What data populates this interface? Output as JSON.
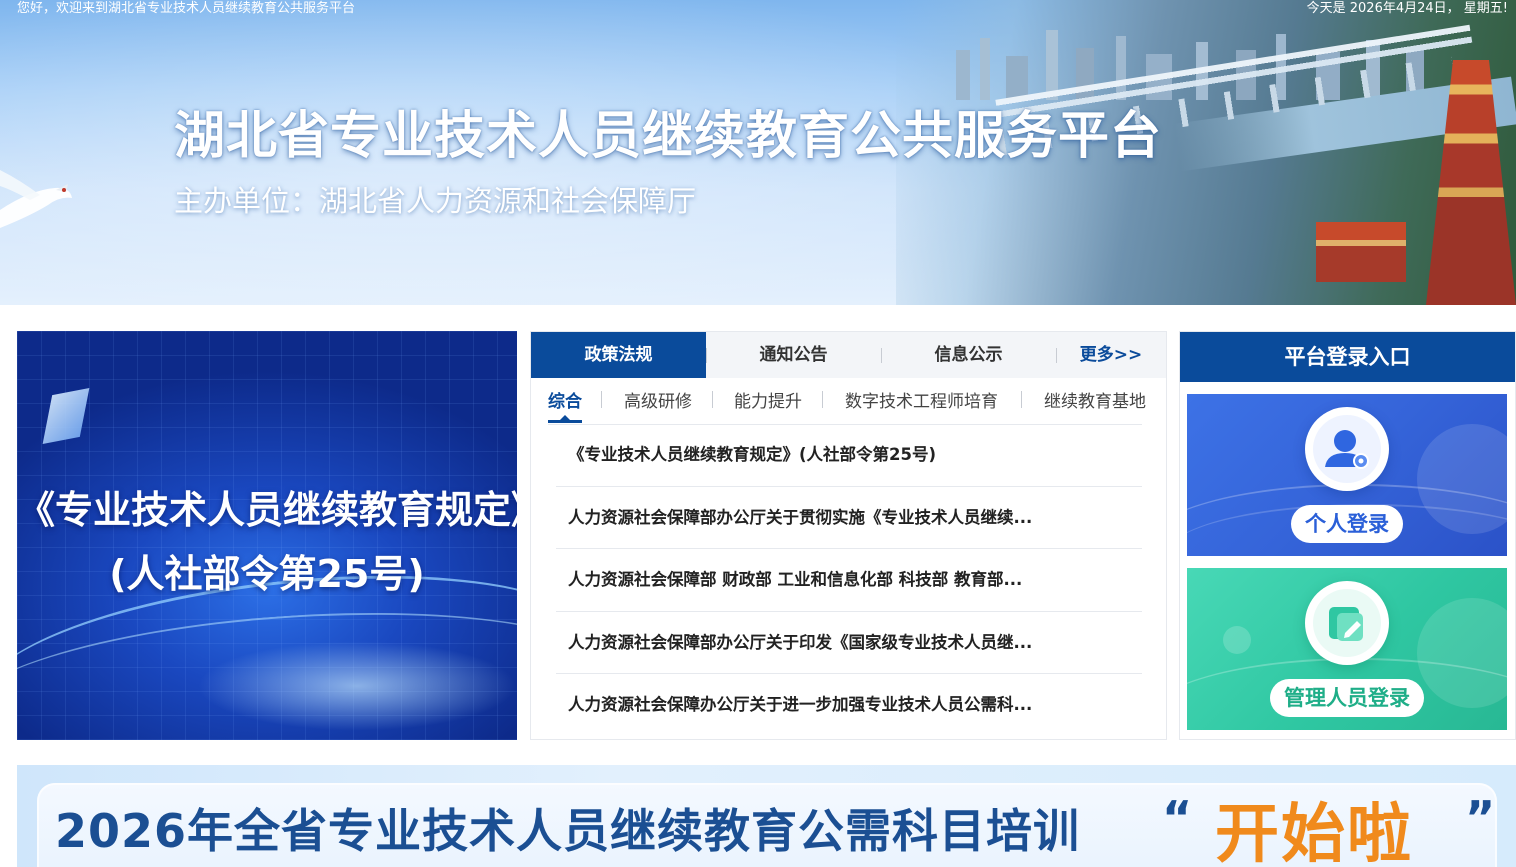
{
  "topbar": {
    "welcome": "您好，欢迎来到湖北省专业技术人员继续教育公共服务平台",
    "date": "今天是 2026年4月24日， 星期五!"
  },
  "banner": {
    "title": "湖北省专业技术人员继续教育公共服务平台",
    "subtitle": "主办单位：湖北省人力资源和社会保障厅"
  },
  "feature": {
    "line1": "《专业技术人员继续教育规定》",
    "line2": "(人社部令第25号)"
  },
  "news": {
    "tabs": [
      {
        "label": "政策法规",
        "active": true
      },
      {
        "label": "通知公告",
        "active": false
      },
      {
        "label": "信息公示",
        "active": false
      }
    ],
    "more": "更多>>",
    "subtabs": [
      {
        "label": "综合",
        "active": true
      },
      {
        "label": "高级研修",
        "active": false
      },
      {
        "label": "能力提升",
        "active": false
      },
      {
        "label": "数字技术工程师培育",
        "active": false
      },
      {
        "label": "继续教育基地",
        "active": false
      }
    ],
    "items": [
      "《专业技术人员继续教育规定》(人社部令第25号)",
      "人力资源社会保障部办公厅关于贯彻实施《专业技术人员继续...",
      "人力资源社会保障部 财政部 工业和信息化部 科技部 教育部...",
      "人力资源社会保障部办公厅关于印发《国家级专业技术人员继...",
      "人力资源社会保障办公厅关于进一步加强专业技术人员公需科..."
    ]
  },
  "login": {
    "title": "平台登录入口",
    "personal": {
      "label": "个人登录",
      "icon": "user-icon"
    },
    "admin": {
      "label": "管理人员登录",
      "icon": "edit-icon"
    }
  },
  "promo": {
    "text": "2026年全省专业技术人员继续教育公需科目培训",
    "quote_open": "“",
    "highlight": "开始啦",
    "quote_close": "”"
  },
  "colors": {
    "primary": "#0a4b9b",
    "personal_card": "#3564d9",
    "admin_card": "#2fc7a2",
    "highlight": "#f08a1c"
  }
}
